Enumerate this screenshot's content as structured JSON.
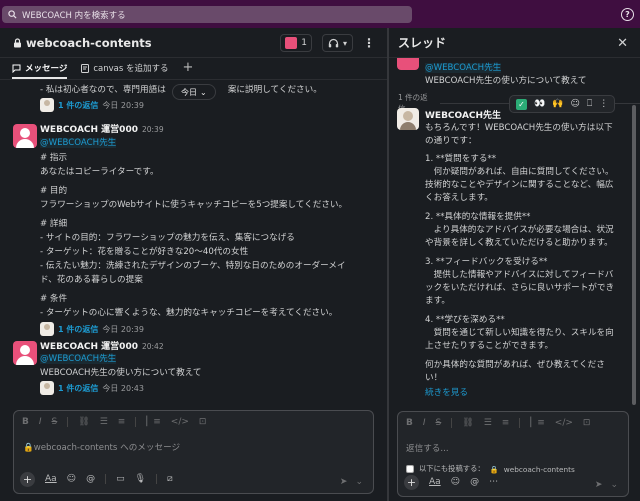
{
  "search": {
    "placeholder": "WEBCOACH 内を検索する"
  },
  "channel": {
    "name": "webcoach-contents",
    "member_count": "1",
    "tabs": [
      {
        "label": "メッセージ"
      },
      {
        "label": "canvas を追加する"
      }
    ],
    "date_divider": "今日",
    "messages": [
      {
        "text_lines": [
          "- 私は初心者なので、専門用語は",
          "案に説明してください。"
        ],
        "reply_link": "1 件の返信",
        "reply_time": "今日 20:39"
      },
      {
        "sender": "WEBCOACH 運営000",
        "time": "20:39",
        "mention": "@WEBCOACH先生",
        "text_lines": [
          "# 指示",
          "あなたはコピーライターです。",
          "# 目的",
          "フラワーショップのWebサイトに使うキャッチコピーを5つ提案してください。",
          "# 詳細",
          "- サイトの目的：フラワーショップの魅力を伝え、集客につなげる",
          "- ターゲット：花を贈ることが好きな20〜40代の女性",
          "- 伝えたい魅力：洗練されたデザインのブーケ、特別な日のためのオーダーメイ",
          "ド、花のある暮らしの提案",
          "# 条件",
          "- ターゲットの心に響くような、魅力的なキャッチコピーを考えてください。"
        ],
        "reply_link": "1 件の返信",
        "reply_time": "今日 20:39"
      },
      {
        "sender": "WEBCOACH 運営000",
        "time": "20:42",
        "mention": "@WEBCOACH先生",
        "text_lines": [
          "WEBCOACH先生の使い方について教えて"
        ],
        "reply_link": "1 件の返信",
        "reply_time": "今日 20:43"
      }
    ],
    "composer_placeholder": "webcoach-contents へのメッセージ"
  },
  "thread": {
    "title": "スレッド",
    "parent": {
      "mention": "@WEBCOACH先生",
      "text": "WEBCOACH先生の使い方について教えて"
    },
    "replies_count": "1 件の返信",
    "reply": {
      "sender": "WEBCOACH先生",
      "text_lines": [
        "もちろんです！WEBCOACH先生の使い方は以下",
        "の通りです：",
        "1. **質問をする**",
        "　何か疑問があれば、自由に質問してください。",
        "技術的なことやデザインに関することなど、幅広",
        "くお答えします。",
        "2. **具体的な情報を提供**",
        "　より具体的なアドバイスが必要な場合は、状況",
        "や背景を詳しく教えていただけると助かります。",
        "3. **フィードバックを受ける**",
        "　提供した情報やアドバイスに対してフィードバ",
        "ックをいただければ、さらに良いサポートができ",
        "ます。",
        "4. **学びを深める**",
        "　質問を通じて新しい知識を得たり、スキルを向",
        "上させたりすることができます。",
        "何か具体的な質問があれば、ぜひ教えてくださ",
        "い！"
      ],
      "more_link": "続きを見る"
    },
    "composer_placeholder": "返信する...",
    "also_send_label": "以下にも投稿する：",
    "also_send_channel": "webcoach-contents"
  }
}
